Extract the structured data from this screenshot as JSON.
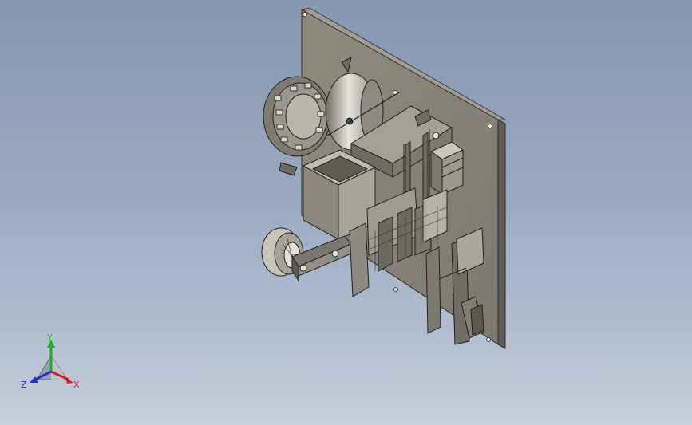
{
  "viewport": {
    "background_top": "#8797b1",
    "background_bottom": "#c6cfdc",
    "model_color": "#8f8c80"
  },
  "triad": {
    "x_label": "X",
    "y_label": "Y",
    "z_label": "Z",
    "x_color": "#d81e1e",
    "y_color": "#1faa2a",
    "z_color": "#2233cc"
  }
}
